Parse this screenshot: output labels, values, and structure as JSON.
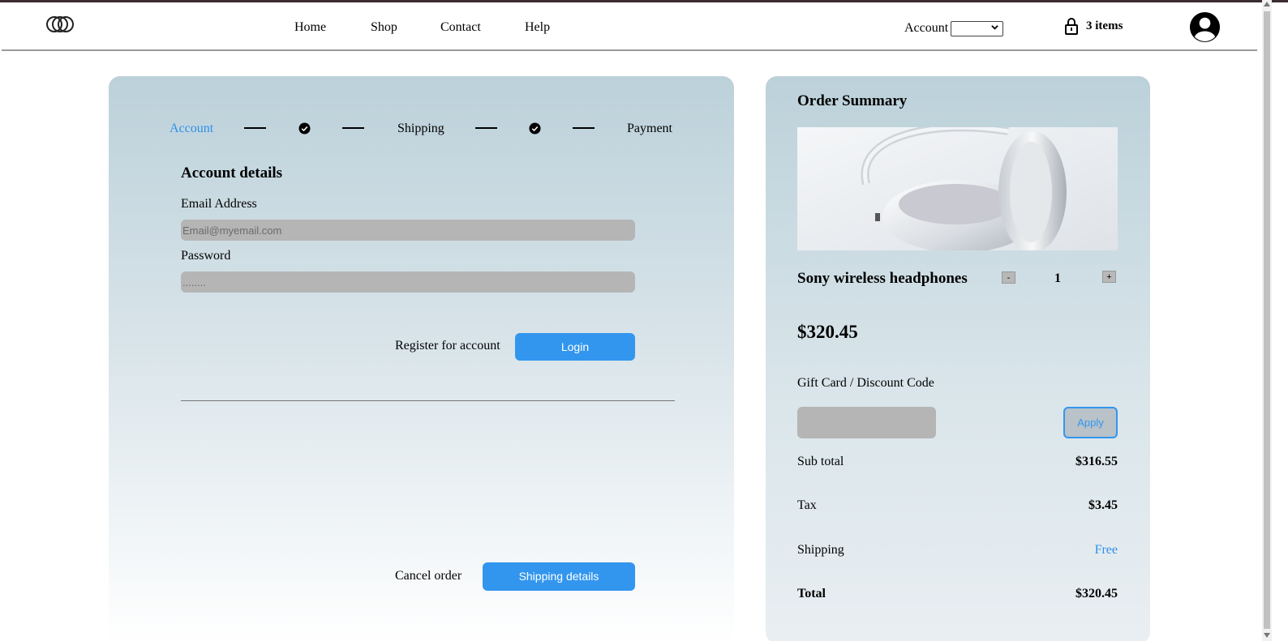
{
  "nav": {
    "home": "Home",
    "shop": "Shop",
    "contact": "Contact",
    "help": "Help"
  },
  "account_menu": {
    "label": "Account",
    "selected": ""
  },
  "cart": {
    "icon": "lock-bag-icon",
    "count_label": "3 items"
  },
  "steps": {
    "account": "Account",
    "shipping": "Shipping",
    "payment": "Payment"
  },
  "account_form": {
    "title": "Account details",
    "email_label": "Email Address",
    "email_placeholder": "Email@myemail.com",
    "password_label": "Password",
    "password_placeholder": "........",
    "register_label": "Register for account",
    "login_label": "Login",
    "cancel_label": "Cancel order",
    "next_label": "Shipping details"
  },
  "order_summary": {
    "title": "Order Summary",
    "product_name": "Sony wireless headphones",
    "quantity": "1",
    "minus_label": "-",
    "plus_label": "+",
    "price": "$320.45",
    "gift_label": "Gift Card / Discount Code",
    "apply_label": "Apply",
    "rows": [
      {
        "label": "Sub total",
        "value": "$316.55"
      },
      {
        "label": "Tax",
        "value": "$3.45"
      },
      {
        "label": "Shipping",
        "value": "Free"
      },
      {
        "label": "Total",
        "value": "$320.45"
      }
    ]
  },
  "colors": {
    "accent": "#3296ee",
    "input_bg": "#b5b5b5",
    "card_top": "#bcd1da"
  }
}
